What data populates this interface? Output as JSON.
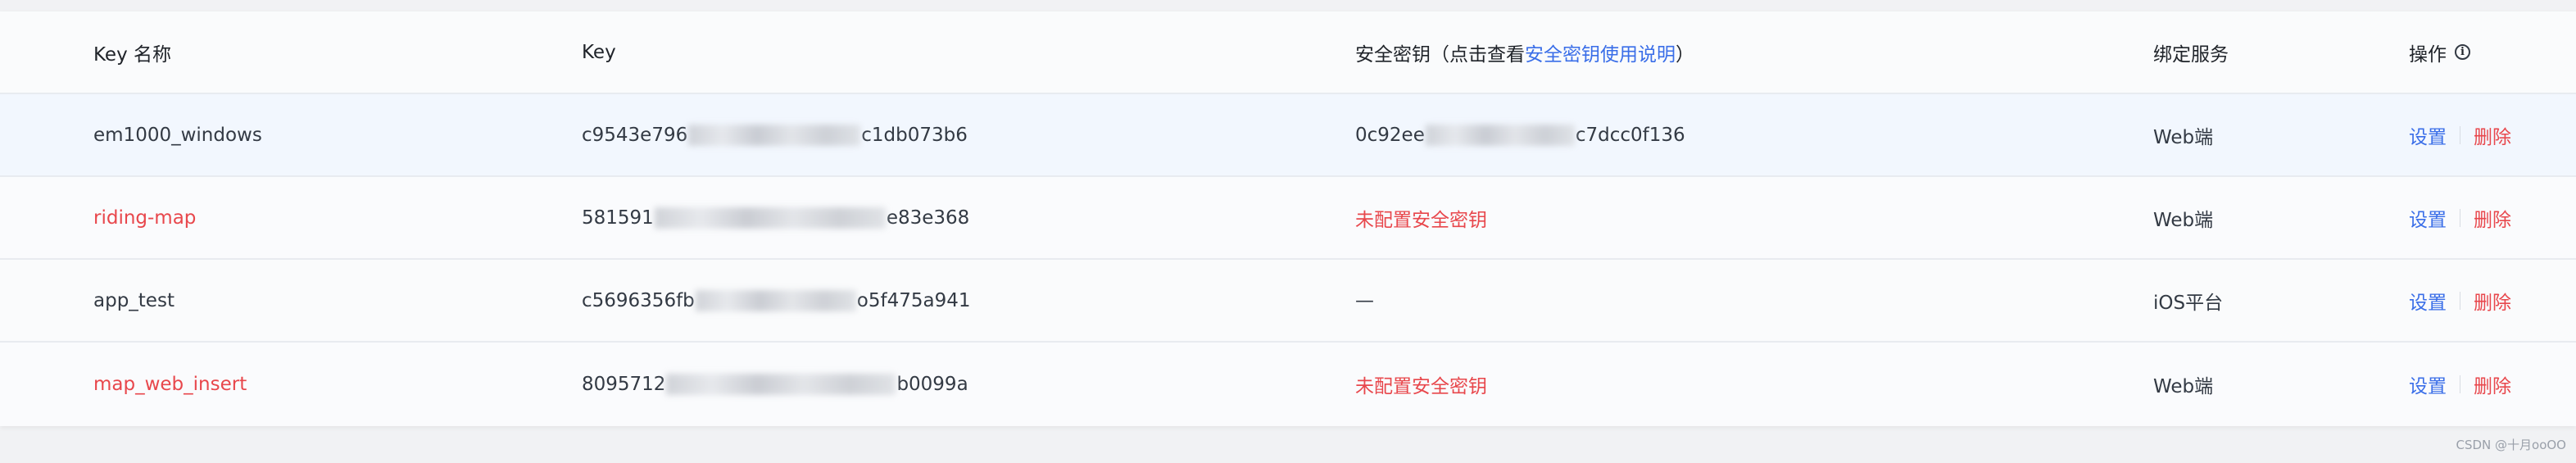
{
  "table": {
    "headers": {
      "name": "Key 名称",
      "key": "Key",
      "secret_prefix": "安全密钥（点击查看",
      "secret_link": "安全密钥使用说明",
      "secret_suffix": "）",
      "service": "绑定服务",
      "ops": "操作"
    },
    "rows": [
      {
        "name": "em1000_windows",
        "key_start": "c9543e796",
        "key_end": "c1db073b6",
        "secret_start": "0c92ee",
        "secret_end": "c7dcc0f136",
        "service": "Web端",
        "set_label": "设置",
        "delete_label": "删除"
      },
      {
        "name": "riding-map",
        "key_start": "581591",
        "key_end": "e83e368",
        "secret_text": "未配置安全密钥",
        "service": "Web端",
        "set_label": "设置",
        "delete_label": "删除"
      },
      {
        "name": "app_test",
        "key_start": "c5696356fb",
        "key_end": "o5f475a941",
        "secret_text": "—",
        "service": "iOS平台",
        "set_label": "设置",
        "delete_label": "删除"
      },
      {
        "name": "map_web_insert",
        "key_start": "8095712",
        "key_end": "b0099a",
        "secret_text": "未配置安全密钥",
        "service": "Web端",
        "set_label": "设置",
        "delete_label": "删除"
      }
    ]
  },
  "watermark": "CSDN @十月ooOO",
  "colors": {
    "link": "#3a6ee8",
    "danger": "#e8474c",
    "row_highlight": "#f2f7fe"
  },
  "icons": {
    "ops_info": "info-icon"
  }
}
